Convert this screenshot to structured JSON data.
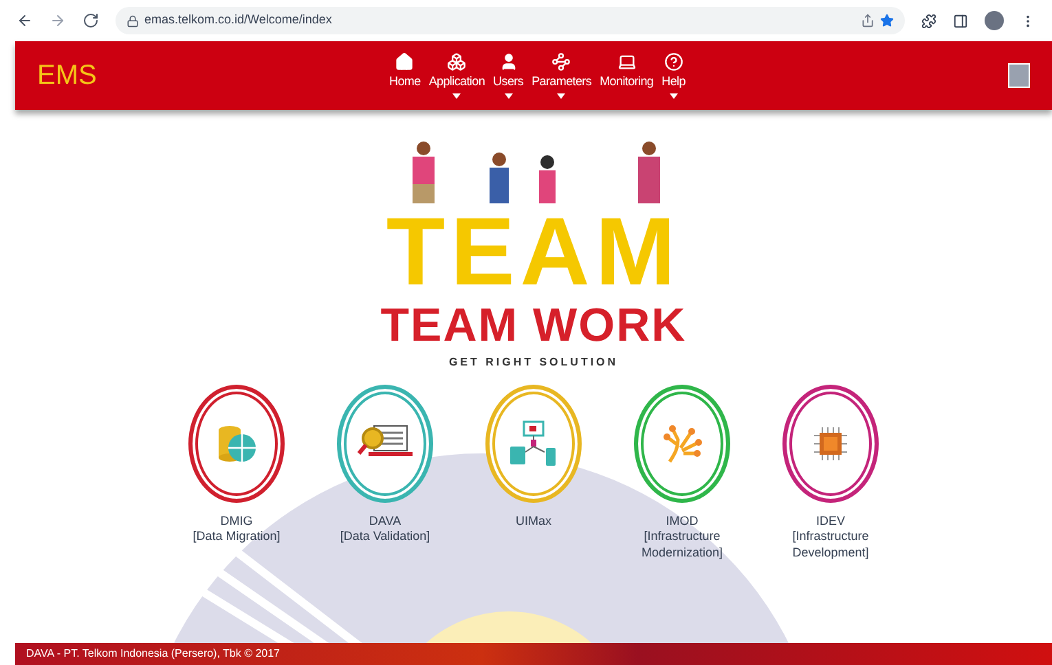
{
  "browser": {
    "url": "emas.telkom.co.id/Welcome/index"
  },
  "header": {
    "logo": "EMS",
    "nav": [
      {
        "kind": "home",
        "label": "Home",
        "has_menu": false
      },
      {
        "kind": "cubes",
        "label": "Application",
        "has_menu": true
      },
      {
        "kind": "user",
        "label": "Users",
        "has_menu": true
      },
      {
        "kind": "params",
        "label": "Parameters",
        "has_menu": true
      },
      {
        "kind": "laptop",
        "label": "Monitoring",
        "has_menu": false
      },
      {
        "kind": "help",
        "label": "Help",
        "has_menu": true
      }
    ]
  },
  "banner": {
    "big_word": "TEAM",
    "title": "TEAM WORK",
    "tagline": "GET RIGHT SOLUTION"
  },
  "apps": [
    {
      "kind": "database",
      "name": "DMIG",
      "desc": "[Data Migration]",
      "color": "#d0202e"
    },
    {
      "kind": "search",
      "name": "DAVA",
      "desc": "[Data Validation]",
      "color": "#3ab5b0"
    },
    {
      "kind": "devices",
      "name": "UIMax",
      "color": "#e8b722"
    },
    {
      "kind": "network",
      "name": "IMOD",
      "desc": "[Infrastructure Modernization]",
      "color": "#2fb64a"
    },
    {
      "kind": "chip",
      "name": "IDEV",
      "desc": "[Infrastructure Development]",
      "color": "#c4247a"
    }
  ],
  "footer": {
    "text": "DAVA - PT. Telkom Indonesia (Persero), Tbk © 2017"
  }
}
